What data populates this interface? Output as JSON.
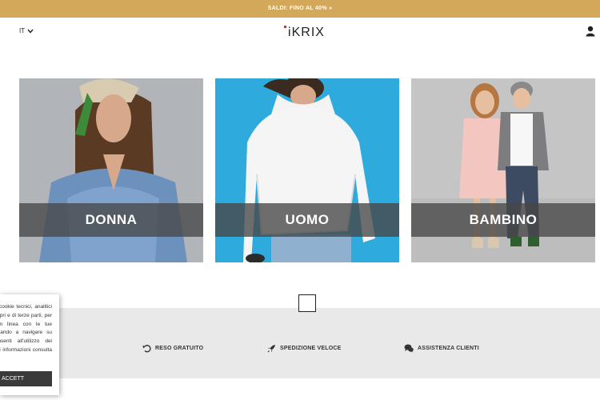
{
  "promo": {
    "text": "SALDI: FINO AL 40% »"
  },
  "header": {
    "language": "IT",
    "logo_text": "iKRIX"
  },
  "categories": [
    {
      "label": "DONNA"
    },
    {
      "label": "UOMO"
    },
    {
      "label": "BAMBINO"
    }
  ],
  "features": [
    {
      "label": "RESO GRATUITO",
      "icon": "return-arrow-icon"
    },
    {
      "label": "SPEDIZIONE VELOCE",
      "icon": "rocket-icon"
    },
    {
      "label": "ASSISTENZA CLIENTI",
      "icon": "chat-bubbles-icon"
    }
  ],
  "cookie_banner": {
    "text": "Questo sito utilizza cookie tecnici, analitici e di profilazione, propri e di terze parti, per inviarti pubblicità in linea con le tue preferenze. Continuando a navigare su questo sito acconsenti all'utilizzo dei cookie. Per maggiori informazioni consulta la privacy policy.",
    "button_label": "ACCETT"
  },
  "colors": {
    "promo_bar": "#d4a85a",
    "features_bg": "#e9e9e9",
    "overlay": "#464646"
  }
}
